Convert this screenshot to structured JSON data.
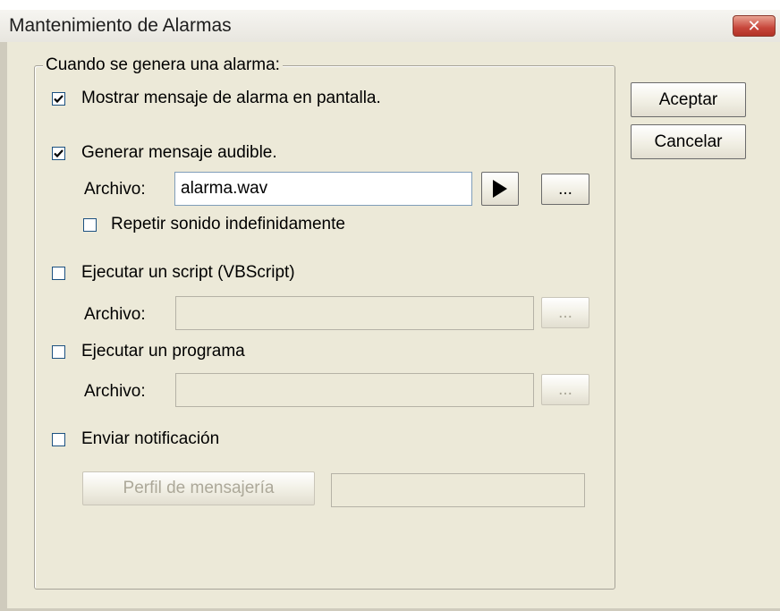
{
  "window": {
    "title": "Mantenimiento de Alarmas"
  },
  "group": {
    "legend": "Cuando se genera una alarma:"
  },
  "options": {
    "show_message": {
      "label": "Mostrar mensaje de alarma en pantalla.",
      "checked": true
    },
    "audible": {
      "label": "Generar mensaje audible.",
      "checked": true
    },
    "audible_file_label": "Archivo:",
    "audible_file_value": "alarma.wav",
    "repeat": {
      "label": "Repetir sonido indefinidamente",
      "checked": false
    },
    "script": {
      "label": "Ejecutar un script (VBScript)",
      "checked": false
    },
    "script_file_label": "Archivo:",
    "program": {
      "label": "Ejecutar un programa",
      "checked": false
    },
    "program_file_label": "Archivo:",
    "notify": {
      "label": "Enviar notificación",
      "checked": false
    },
    "messaging_profile_label": "Perfil de mensajería"
  },
  "buttons": {
    "browse": "...",
    "accept": "Aceptar",
    "cancel": "Cancelar"
  },
  "icons": {
    "play": "play-icon",
    "close": "close-icon",
    "check": "check-icon"
  }
}
